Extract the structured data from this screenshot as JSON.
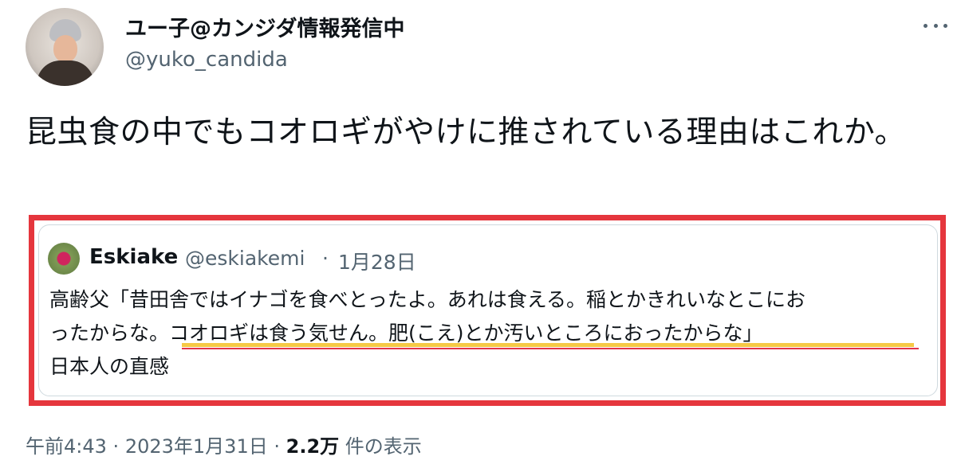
{
  "author": {
    "display_name": "ユー子@カンジダ情報発信中",
    "handle": "@yuko_candida"
  },
  "tweet": {
    "text": "昆虫食の中でもコオロギがやけに推されている理由はこれか。"
  },
  "quoted": {
    "name": "Eskiake",
    "handle": "@eskiakemi",
    "separator": "·",
    "date": "1月28日",
    "text_line1": "高齢父「昔田舎ではイナゴを食べとったよ。あれは食える。稲とかきれいなとこにお",
    "text_line2": "ったからな。コオロギは食う気せん。肥(こえ)とか汚いところにおったからな」",
    "text_line3": "日本人の直感"
  },
  "meta": {
    "time": "午前4:43",
    "sep1": "·",
    "date": "2023年1月31日",
    "sep2": "·",
    "views_count": "2.2万",
    "views_label": "件の表示"
  },
  "icons": {
    "more": "more-options-icon"
  },
  "colors": {
    "highlight_border": "#e5363d",
    "underline_yellow": "#f6c945",
    "underline_red": "#e2344b",
    "secondary_text": "#536471"
  }
}
